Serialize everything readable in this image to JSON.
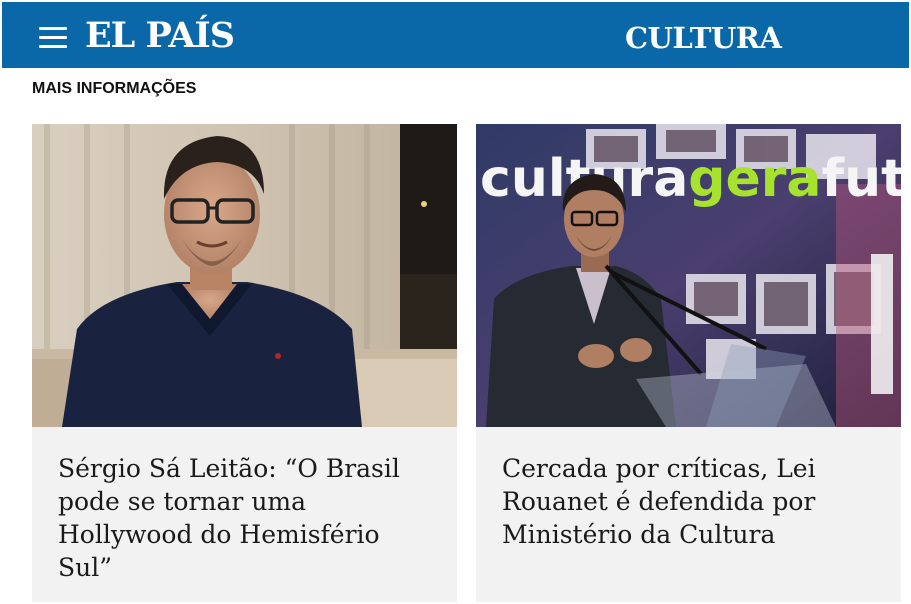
{
  "header": {
    "logo": "EL PAÍS",
    "section": "CULTURA",
    "menu_icon": "hamburger-menu-icon",
    "background_color": "#0A68A8"
  },
  "more_info_label": "MAIS INFORMAÇÕES",
  "articles": [
    {
      "title": "Sérgio Sá Leitão: “O Brasil pode se tornar uma Hollywood do Hemisfério Sul”"
    },
    {
      "title": "Cercada por críticas, Lei Rouanet é defendida por Ministério da Cultura",
      "image_text": {
        "part1": "cultura",
        "part2": "gera",
        "part3": "futu",
        "accent_color": "#a6e22e"
      }
    }
  ]
}
